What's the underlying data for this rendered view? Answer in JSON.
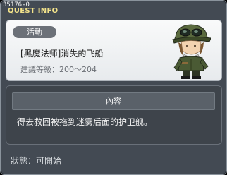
{
  "window": {
    "quest_id": "35176-0",
    "title": "QUEST INFO"
  },
  "quest": {
    "category": "活動",
    "name": "[黑魔法师]消失的飞船",
    "recommended_level": "建議等級：200～204",
    "npc_icon": "soldier-npc-icon"
  },
  "details": {
    "section_label": "內容",
    "description": "得去救回被拖到迷雾后面的护卫舰。"
  },
  "status": {
    "text": "狀態：可開始"
  },
  "colors": {
    "window_bg": "#434a53",
    "title": "#f2e28a",
    "panel_light": "#f4f6f7",
    "panel_dark": "#3e444b"
  }
}
